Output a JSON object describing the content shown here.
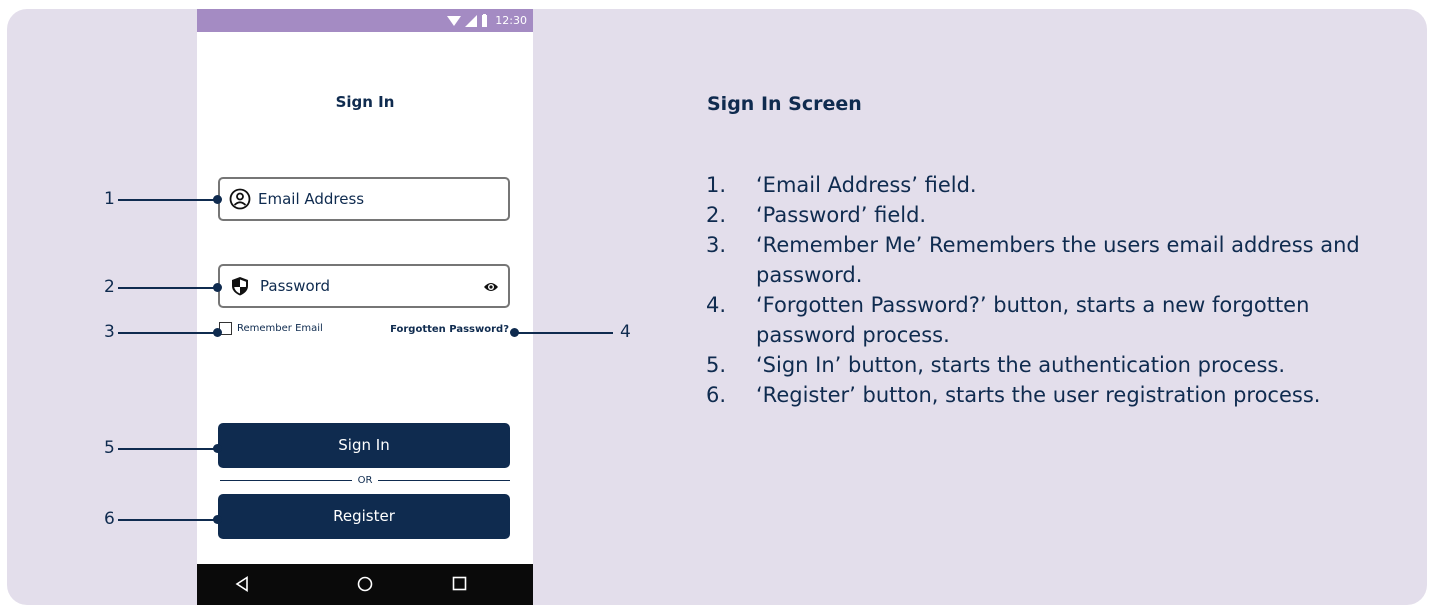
{
  "status_bar": {
    "time": "12:30"
  },
  "sign_in_screen": {
    "title": "Sign In",
    "email_placeholder": "Email Address",
    "password_placeholder": "Password",
    "remember_label": "Remember Email",
    "forgot_label": "Forgotten Password?",
    "signin_label": "Sign In",
    "or_label": "OR",
    "register_label": "Register"
  },
  "callouts": [
    "1",
    "2",
    "3",
    "4",
    "5",
    "6"
  ],
  "description": {
    "title": "Sign In Screen",
    "items": [
      {
        "num": "1.",
        "text": "‘Email Address’ field."
      },
      {
        "num": "2.",
        "text": "‘Password’ field."
      },
      {
        "num": "3.",
        "text": "‘Remember Me’ Remembers the users email address and password."
      },
      {
        "num": "4.",
        "text": "‘Forgotten Password?’ button, starts a new forgotten password process."
      },
      {
        "num": "5.",
        "text": "‘Sign In’ button, starts the authentication process."
      },
      {
        "num": "6.",
        "text": "‘Register’ button, starts the user registration process."
      }
    ]
  },
  "colors": {
    "panel": "#e3deeb",
    "navy": "#0f2b4f",
    "status_bar": "#a48bc3"
  }
}
